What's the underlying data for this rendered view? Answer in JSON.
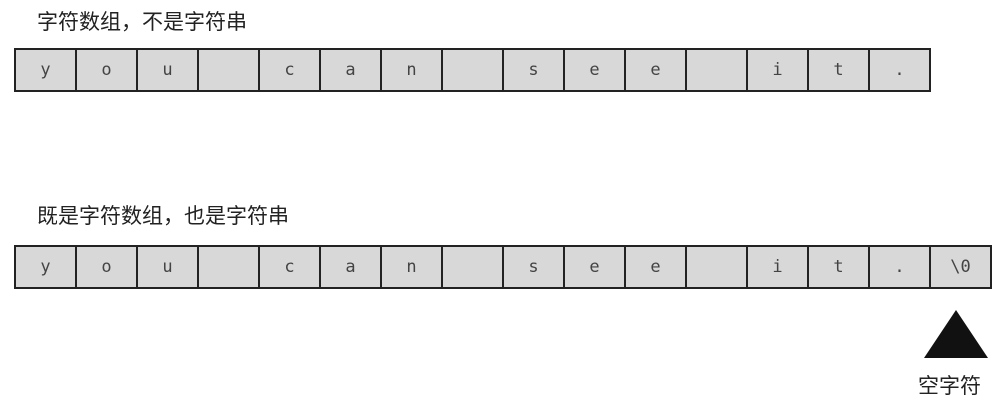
{
  "diagram": {
    "array_only": {
      "title": "字符数组，不是字符串",
      "cells": [
        "y",
        "o",
        "u",
        " ",
        "c",
        "a",
        "n",
        " ",
        "s",
        "e",
        "e",
        " ",
        "i",
        "t",
        "."
      ]
    },
    "string": {
      "title": "既是字符数组，也是字符串",
      "cells": [
        "y",
        "o",
        "u",
        " ",
        "c",
        "a",
        "n",
        " ",
        "s",
        "e",
        "e",
        " ",
        "i",
        "t",
        ".",
        "\\0"
      ]
    },
    "null_char_label": "空字符"
  }
}
